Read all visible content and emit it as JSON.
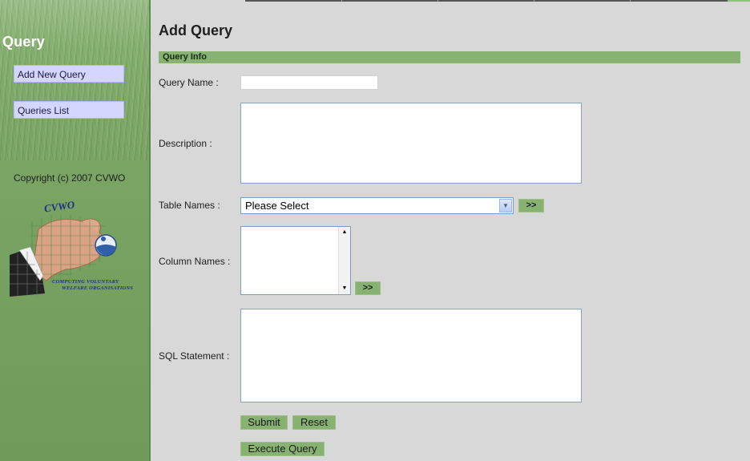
{
  "sidebar": {
    "title": "Query",
    "items": [
      {
        "label": "Add New Query"
      },
      {
        "label": "Queries List"
      }
    ],
    "copyright": "Copyright (c) 2007 CVWO",
    "logo": {
      "name": "CVWO",
      "line1": "COMPUTING VOLUNTARY",
      "line2": "WELFARE ORGANISATIONS"
    }
  },
  "main": {
    "title": "Add Query",
    "section": "Query Info",
    "labels": {
      "query_name": "Query Name :",
      "description": "Description :",
      "table_names": "Table Names :",
      "column_names": "Column Names :",
      "sql_statement": "SQL Statement :"
    },
    "table_select_value": "Please Select",
    "add_table_label": ">>",
    "add_column_label": ">>",
    "buttons": {
      "submit": "Submit",
      "reset": "Reset",
      "execute": "Execute Query"
    }
  },
  "colors": {
    "sidebar_green": "#7fa968",
    "section_green": "#88b272",
    "nav_button": "#d4d6ff",
    "background": "#d8d8d8"
  }
}
